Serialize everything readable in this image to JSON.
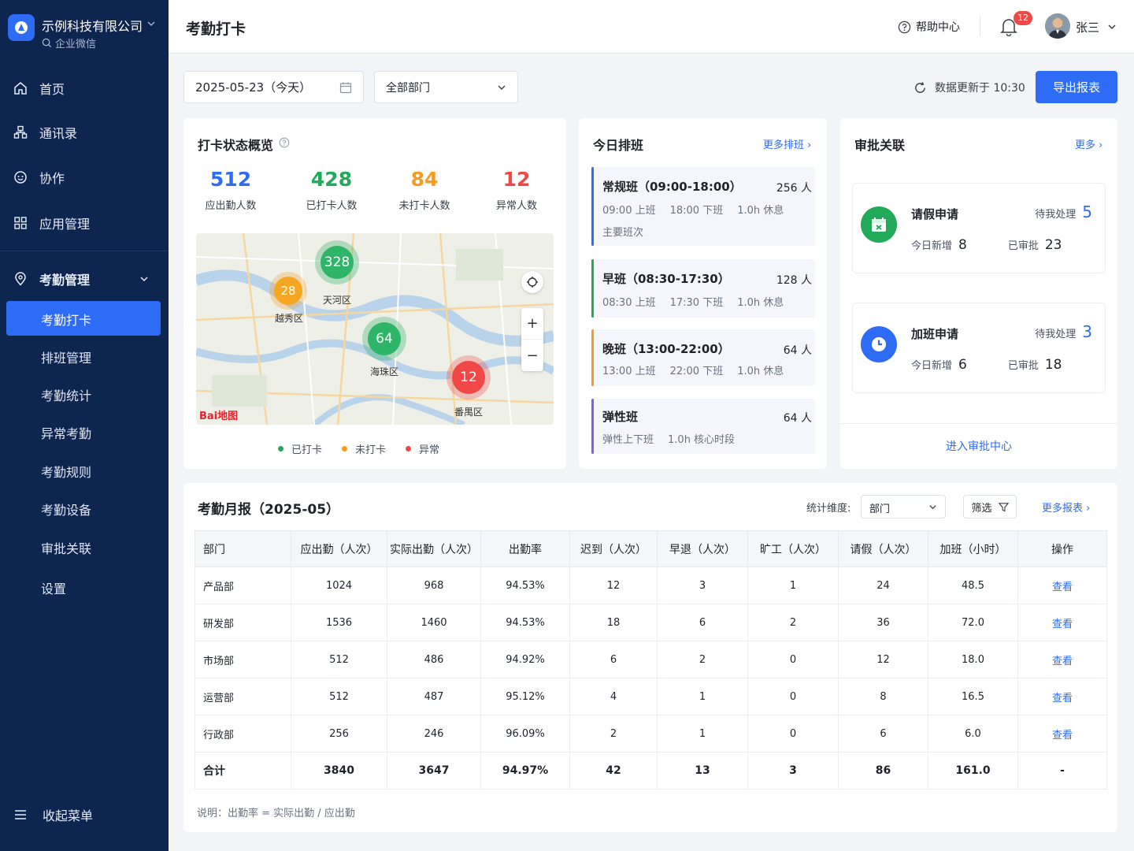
{
  "sidebar": {
    "company": "示例科技有限公司",
    "subtitle": "企业微信",
    "nav": [
      {
        "label": "首页",
        "icon": "home-icon"
      },
      {
        "label": "通讯录",
        "icon": "contacts-icon"
      },
      {
        "label": "协作",
        "icon": "chat-icon"
      },
      {
        "label": "应用管理",
        "icon": "apps-icon"
      }
    ],
    "group": {
      "label": "考勤管理",
      "icon": "location-icon"
    },
    "sub_items": [
      "考勤打卡",
      "排班管理",
      "考勤统计",
      "异常考勤",
      "考勤规则",
      "考勤设备",
      "审批关联",
      "设置"
    ],
    "collapse": "收起菜单"
  },
  "header": {
    "title": "考勤打卡",
    "help": "帮助中心",
    "notifications": "12",
    "user": "张三"
  },
  "toolbar": {
    "date": "2025-05-23（今天）",
    "department": "全部部门",
    "update": "数据更新于 10:30",
    "export": "导出报表"
  },
  "overview": {
    "title": "打卡状态概览",
    "stats": [
      {
        "value": "512",
        "label": "应出勤人数",
        "color": "#2f6cf6"
      },
      {
        "value": "428",
        "label": "已打卡人数",
        "color": "#22a95a"
      },
      {
        "value": "84",
        "label": "未打卡人数",
        "color": "#f59a23"
      },
      {
        "value": "12",
        "label": "异常人数",
        "color": "#f04747"
      }
    ],
    "map": {
      "clusters": [
        "328",
        "28",
        "64",
        "12"
      ],
      "districts": [
        "天河区",
        "越秀区",
        "海珠区",
        "番禺区"
      ],
      "logo": "Bai地图"
    },
    "legend": [
      "已打卡",
      "未打卡",
      "异常"
    ]
  },
  "schedule": {
    "title": "今日排班",
    "more": "更多排班",
    "shifts": [
      {
        "name": "常规班（09:00-18:00）",
        "count": "256 人",
        "meta": [
          "09:00 上班",
          "18:00 下班",
          "1.0h 休息"
        ],
        "tag": "主要班次",
        "color": "#2f6cf6"
      },
      {
        "name": "早班（08:30-17:30）",
        "count": "128 人",
        "meta": [
          "08:30 上班",
          "17:30 下班",
          "1.0h 休息"
        ],
        "color": "#22a95a"
      },
      {
        "name": "晚班（13:00-22:00）",
        "count": "64 人",
        "meta": [
          "13:00 上班",
          "22:00 下班",
          "1.0h 休息"
        ],
        "color": "#f59a23"
      },
      {
        "name": "弹性班",
        "count": "64 人",
        "meta": [
          "弹性上下班",
          "1.0h 核心时段"
        ],
        "color": "#7b61e8"
      }
    ]
  },
  "approval": {
    "title": "审批关联",
    "more": "更多",
    "items": [
      {
        "title": "请假申请",
        "pending_label": "待我处理",
        "pending": "5",
        "new_label": "今日新增",
        "new": "8",
        "done_label": "已审批",
        "done": "23",
        "color": "#22a95a",
        "icon": "calendar-icon"
      },
      {
        "title": "加班申请",
        "pending_label": "待我处理",
        "pending": "3",
        "new_label": "今日新增",
        "new": "6",
        "done_label": "已审批",
        "done": "18",
        "color": "#2f6cf6",
        "icon": "clock-icon"
      }
    ],
    "enter": "进入审批中心"
  },
  "report": {
    "title": "考勤月报（2025-05）",
    "dimension_label": "统计维度:",
    "dimension": "部门",
    "filter": "筛选",
    "more": "更多报表",
    "columns": [
      "部门",
      "应出勤（人次）",
      "实际出勤（人次）",
      "出勤率",
      "迟到（人次）",
      "早退（人次）",
      "旷工（人次）",
      "请假（人次）",
      "加班（小时）",
      "操作"
    ],
    "rows": [
      [
        "产品部",
        "1024",
        "968",
        "94.53%",
        "12",
        "3",
        "1",
        "24",
        "48.5",
        "查看"
      ],
      [
        "研发部",
        "1536",
        "1460",
        "94.53%",
        "18",
        "6",
        "2",
        "36",
        "72.0",
        "查看"
      ],
      [
        "市场部",
        "512",
        "486",
        "94.92%",
        "6",
        "2",
        "0",
        "12",
        "18.0",
        "查看"
      ],
      [
        "运营部",
        "512",
        "487",
        "95.12%",
        "4",
        "1",
        "0",
        "8",
        "16.5",
        "查看"
      ],
      [
        "行政部",
        "256",
        "246",
        "96.09%",
        "2",
        "1",
        "0",
        "6",
        "6.0",
        "查看"
      ]
    ],
    "total": [
      "合计",
      "3840",
      "3647",
      "94.97%",
      "42",
      "13",
      "3",
      "86",
      "161.0",
      "-"
    ],
    "note": "说明：出勤率 = 实际出勤 / 应出勤"
  }
}
